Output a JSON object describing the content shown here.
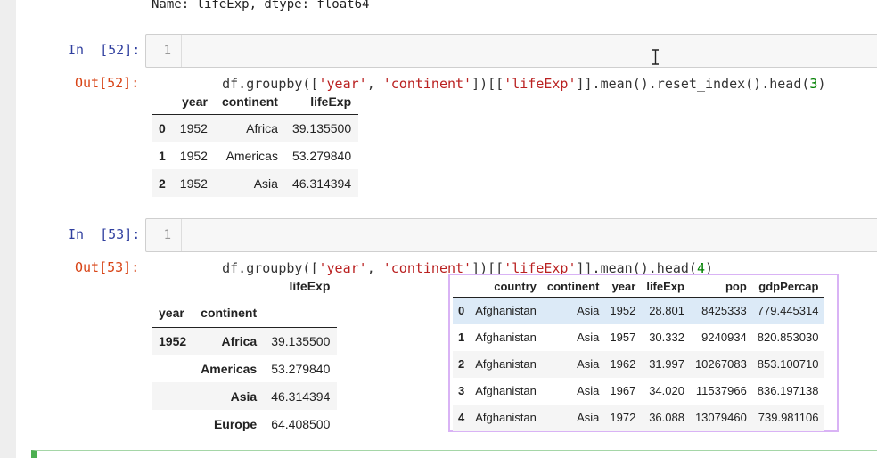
{
  "top_output": "Name: lifeExp, dtype: float64",
  "cell52": {
    "in_prompt": "In  [52]:",
    "out_prompt": "Out[52]:",
    "line_number": "1",
    "code_parts": [
      "df.groupby([",
      "'year'",
      ", ",
      "'continent'",
      "])[[",
      "'lifeExp'",
      "]].mean().reset_index().head(",
      "3",
      ")"
    ],
    "table": {
      "columns": [
        "",
        "year",
        "continent",
        "lifeExp"
      ],
      "rows": [
        [
          "0",
          "1952",
          "Africa",
          "39.135500"
        ],
        [
          "1",
          "1952",
          "Americas",
          "53.279840"
        ],
        [
          "2",
          "1952",
          "Asia",
          "46.314394"
        ]
      ]
    }
  },
  "cell53": {
    "in_prompt": "In  [53]:",
    "out_prompt": "Out[53]:",
    "line_number": "1",
    "code_parts": [
      "df.groupby([",
      "'year'",
      ", ",
      "'continent'",
      "])[[",
      "'lifeExp'",
      "]].mean().head(",
      "4",
      ")"
    ],
    "table": {
      "value_column": "lifeExp",
      "index_names": [
        "year",
        "continent"
      ],
      "rows": [
        [
          "1952",
          "Africa",
          "39.135500"
        ],
        [
          "",
          "Americas",
          "53.279840"
        ],
        [
          "",
          "Asia",
          "46.314394"
        ],
        [
          "",
          "Europe",
          "64.408500"
        ]
      ]
    }
  },
  "overlay_table": {
    "columns": [
      "",
      "country",
      "continent",
      "year",
      "lifeExp",
      "pop",
      "gdpPercap"
    ],
    "rows": [
      [
        "0",
        "Afghanistan",
        "Asia",
        "1952",
        "28.801",
        "8425333",
        "779.445314"
      ],
      [
        "1",
        "Afghanistan",
        "Asia",
        "1957",
        "30.332",
        "9240934",
        "820.853030"
      ],
      [
        "2",
        "Afghanistan",
        "Asia",
        "1962",
        "31.997",
        "10267083",
        "853.100710"
      ],
      [
        "3",
        "Afghanistan",
        "Asia",
        "1967",
        "34.020",
        "11537966",
        "836.197138"
      ],
      [
        "4",
        "Afghanistan",
        "Asia",
        "1972",
        "36.088",
        "13079460",
        "739.981106"
      ]
    ]
  },
  "colors": {
    "in_prompt": "#303f9f",
    "out_prompt": "#d84315",
    "string_token": "#ba2121",
    "number_token": "#008000",
    "overlay_border": "#d9b3f5",
    "selected_cell_bar": "#4caf50"
  },
  "icons": {
    "text_cursor": "i-beam-cursor-icon"
  }
}
